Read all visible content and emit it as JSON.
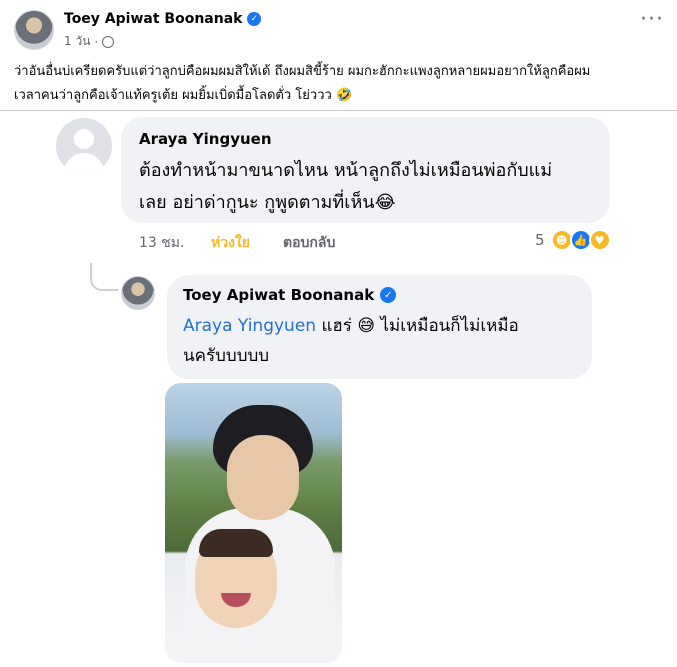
{
  "post": {
    "author": "Toey Apiwat Boonanak",
    "time": "1 วัน",
    "text_line1": "ว่าอันอื่นบ่เครียดครับแต่ว่าลูกบ่คือผมผมสิให้เด้ ถึงผมสิขี้ร้าย ผมกะฮักกะแพงลูกหลายผมอยากให้ลูกคือผม",
    "text_line2": "เวลาคนว่าลูกคือเจ้าแท้ครูเต้ย ผมยิ้มเบิ่ดมื้อโลดตั่ว โย่ววว 🤣"
  },
  "comment1": {
    "author": "Araya Yingyuen",
    "text_line1": "ต้องทำหน้ามาขนาดไหน หน้าลูกถึงไม่เหมือนพ่อกับแม่",
    "text_line2": "เลย อย่าด่ากูนะ กูพูดตามที่เห็น😂",
    "time": "13 ชม.",
    "like_label": "ห่วงใย",
    "reply_label": "ตอบกลับ",
    "reaction_count": "5",
    "reaction_icons": [
      "haha-icon",
      "like-icon",
      "care-icon"
    ]
  },
  "comment2": {
    "author": "Toey Apiwat Boonanak",
    "mention": "Araya Yingyuen",
    "text_after_mention": " แฮร่ 😅 ไม่เหมือนก็ไม่เหมือ",
    "text_line2": "นครับบบบบ"
  },
  "colors": {
    "verified": "#1877f2",
    "mention": "#216fdb",
    "care_reaction": "#f7b928",
    "bubble": "#f0f2f5"
  }
}
